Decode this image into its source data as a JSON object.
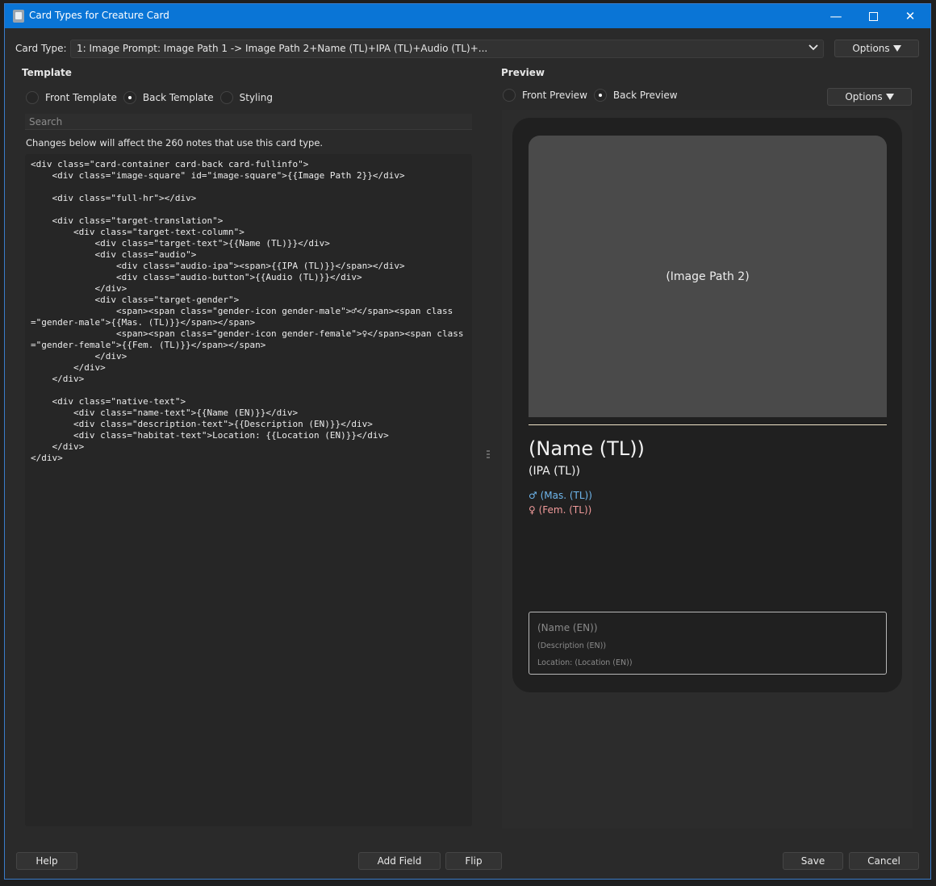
{
  "window": {
    "title": "Card Types for Creature Card",
    "min_glyph": "—",
    "close_glyph": "✕"
  },
  "card_type": {
    "label": "Card Type:",
    "value": "1: Image Prompt: Image Path 1 -> Image Path 2+Name (TL)+IPA (TL)+Audio (TL)+..."
  },
  "options_label": "Options",
  "template": {
    "title": "Template",
    "radios": [
      {
        "label": "Front Template",
        "selected": false
      },
      {
        "label": "Back Template",
        "selected": true
      },
      {
        "label": "Styling",
        "selected": false
      }
    ],
    "search_placeholder": "Search",
    "notice": "Changes below will affect the 260 notes that use this card type.",
    "code_lines": [
      "<div class=\"card-container card-back card-fullinfo\">",
      "    <div class=\"image-square\" id=\"image-square\">{{Image Path 2}}</div>",
      "",
      "    <div class=\"full-hr\"></div>",
      "",
      "    <div class=\"target-translation\">",
      "        <div class=\"target-text-column\">",
      "            <div class=\"target-text\">{{Name (TL)}}</div>",
      "            <div class=\"audio\">",
      "                <div class=\"audio-ipa\"><span>{{IPA (TL)}}</span></div>",
      "                <div class=\"audio-button\">{{Audio (TL)}}</div>",
      "            </div>",
      "            <div class=\"target-gender\">",
      "                <span><span class=\"gender-icon gender-male\">♂</span><span class=\"gender-male\">{{Mas. (TL)}}</span></span>",
      "                <span><span class=\"gender-icon gender-female\">♀</span><span class=\"gender-female\">{{Fem. (TL)}}</span></span>",
      "            </div>",
      "        </div>",
      "    </div>",
      "",
      "    <div class=\"native-text\">",
      "        <div class=\"name-text\">{{Name (EN)}}</div>",
      "        <div class=\"description-text\">{{Description (EN)}}</div>",
      "        <div class=\"habitat-text\">Location: {{Location (EN)}}</div>",
      "    </div>",
      "</div>"
    ]
  },
  "preview": {
    "title": "Preview",
    "radios": [
      {
        "label": "Front Preview",
        "selected": false
      },
      {
        "label": "Back Preview",
        "selected": true
      }
    ],
    "card": {
      "image_placeholder": "(Image Path 2)",
      "name_tl": "(Name (TL))",
      "ipa_tl": "(IPA (TL))",
      "male_symbol": "♂",
      "male_text": "(Mas. (TL))",
      "female_symbol": "♀",
      "female_text": "(Fem. (TL))",
      "name_en": "(Name (EN))",
      "description_en": "(Description (EN))",
      "location_en": "Location: (Location (EN))"
    }
  },
  "footer": {
    "help": "Help",
    "add_field": "Add Field",
    "flip": "Flip",
    "save": "Save",
    "cancel": "Cancel"
  },
  "colors": {
    "titlebar": "#0a75d6",
    "male": "#6fb7ee",
    "female": "#f09a9a",
    "divider": "#f0e4c8"
  }
}
